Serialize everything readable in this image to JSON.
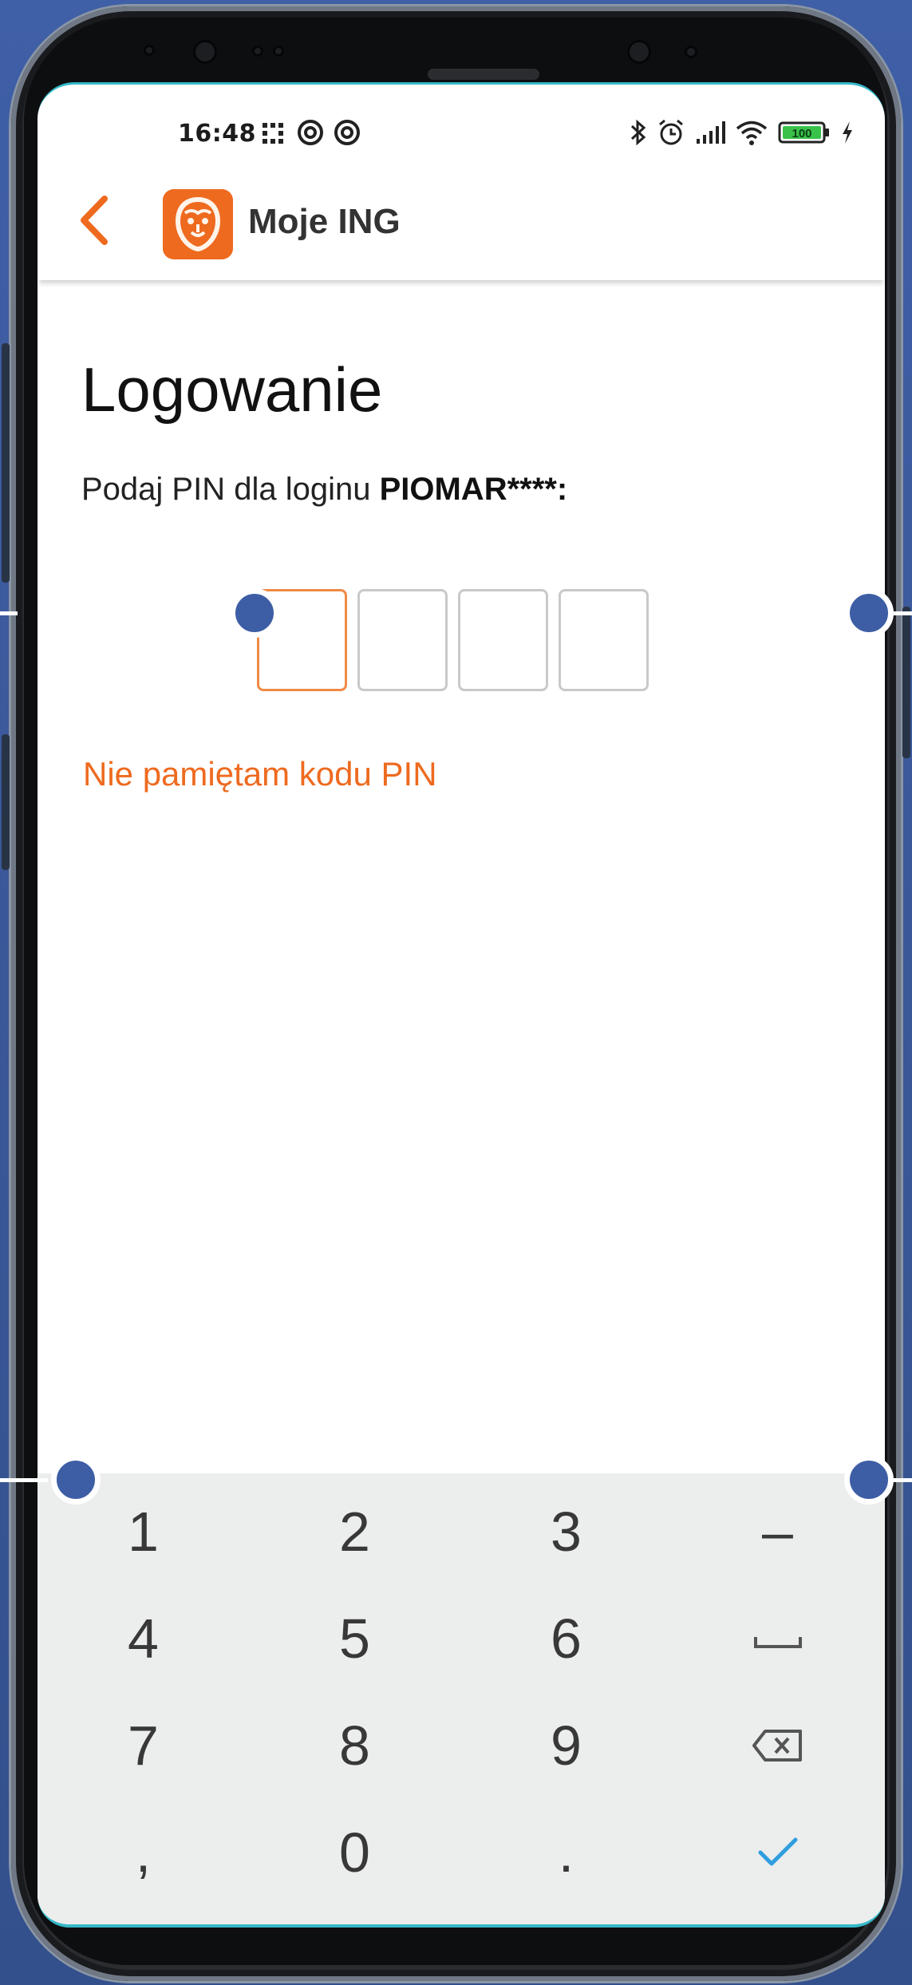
{
  "status_bar": {
    "time": "16:48",
    "battery": "100",
    "left_icons": [
      "notification-grid-icon",
      "sync-icon",
      "sync-icon"
    ],
    "right_icons": [
      "bluetooth-icon",
      "alarm-icon",
      "signal-icon",
      "wifi-icon",
      "battery-icon",
      "charging-icon"
    ]
  },
  "app_bar": {
    "title": "Moje ING",
    "back_icon": "chevron-left-icon",
    "logo_icon": "ing-lion-logo"
  },
  "login": {
    "heading": "Logowanie",
    "prompt_prefix": "Podaj PIN dla loginu ",
    "login_name": "PIOMAR****:",
    "pin_length": 4,
    "pin_filled": 0,
    "forgot_pin_link": "Nie pamiętam kodu PIN"
  },
  "keyboard": {
    "rows": [
      [
        "1",
        "2",
        "3",
        "–"
      ],
      [
        "4",
        "5",
        "6",
        "space-icon"
      ],
      [
        "7",
        "8",
        "9",
        "backspace-icon"
      ],
      [
        ",",
        "0",
        ".",
        "checkmark-icon"
      ]
    ]
  },
  "colors": {
    "accent": "#ee6a1f",
    "pin_border": "#c9c9c9",
    "pin_active_border": "#f08a45",
    "keyboard_bg": "#eceded",
    "checkmark": "#2f9de0",
    "overlay_dot": "#3d5ea5"
  }
}
